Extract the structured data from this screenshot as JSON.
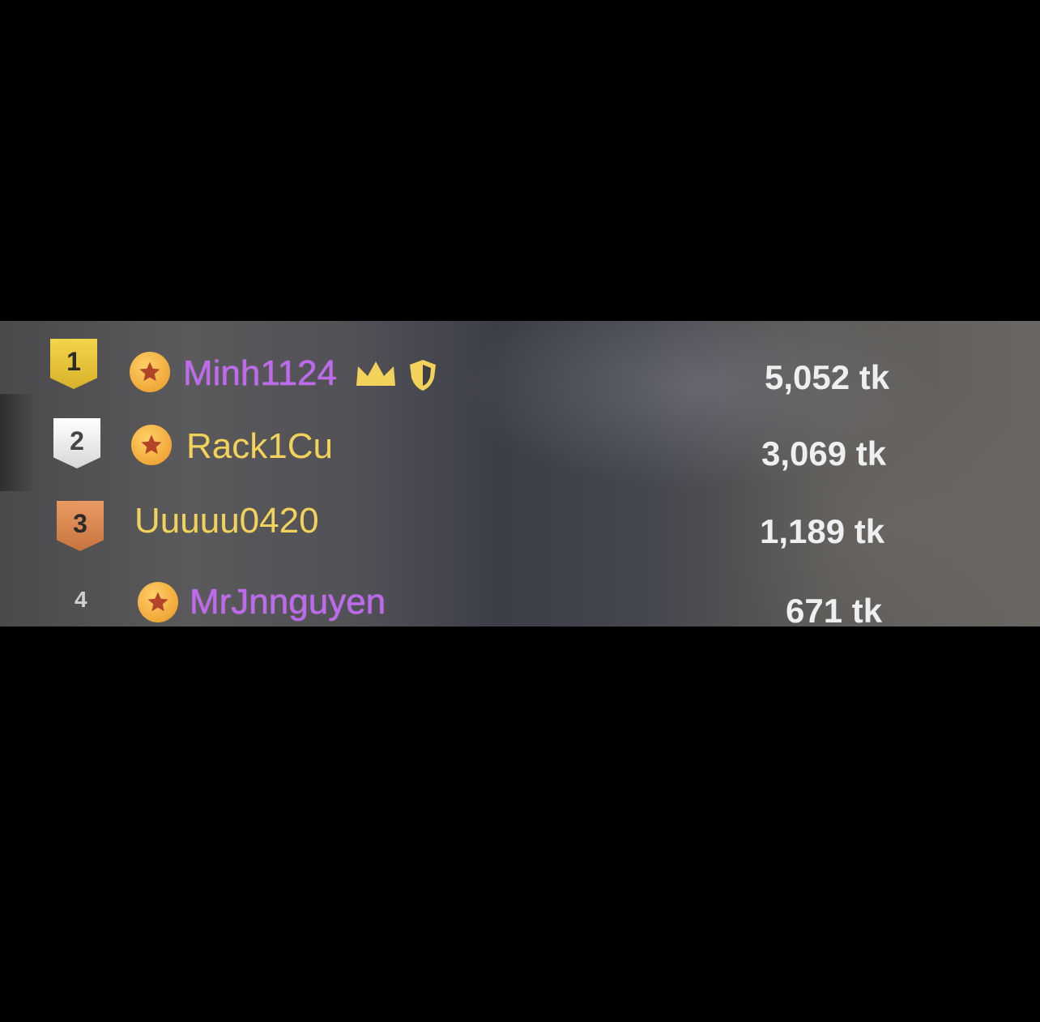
{
  "leaderboard": {
    "rows": [
      {
        "rank": "1",
        "username": "Minh1124",
        "tokens": "5,052 tk"
      },
      {
        "rank": "2",
        "username": "Rack1Cu",
        "tokens": "3,069 tk"
      },
      {
        "rank": "3",
        "username": "Uuuuu0420",
        "tokens": "1,189 tk"
      },
      {
        "rank": "4",
        "username": "MrJnnguyen",
        "tokens": "671 tk"
      }
    ]
  },
  "icons": {
    "medal": "ribbon-medal-icon",
    "star_badge": "star-badge-icon",
    "crown": "crown-icon",
    "shield": "shield-icon"
  },
  "colors": {
    "username_purple": "#c068f0",
    "username_yellow": "#f2d25a",
    "medal_gold": "#e8c53a",
    "medal_silver": "#f2f2f2",
    "medal_bronze": "#d9834c",
    "token_text": "#efefef"
  }
}
